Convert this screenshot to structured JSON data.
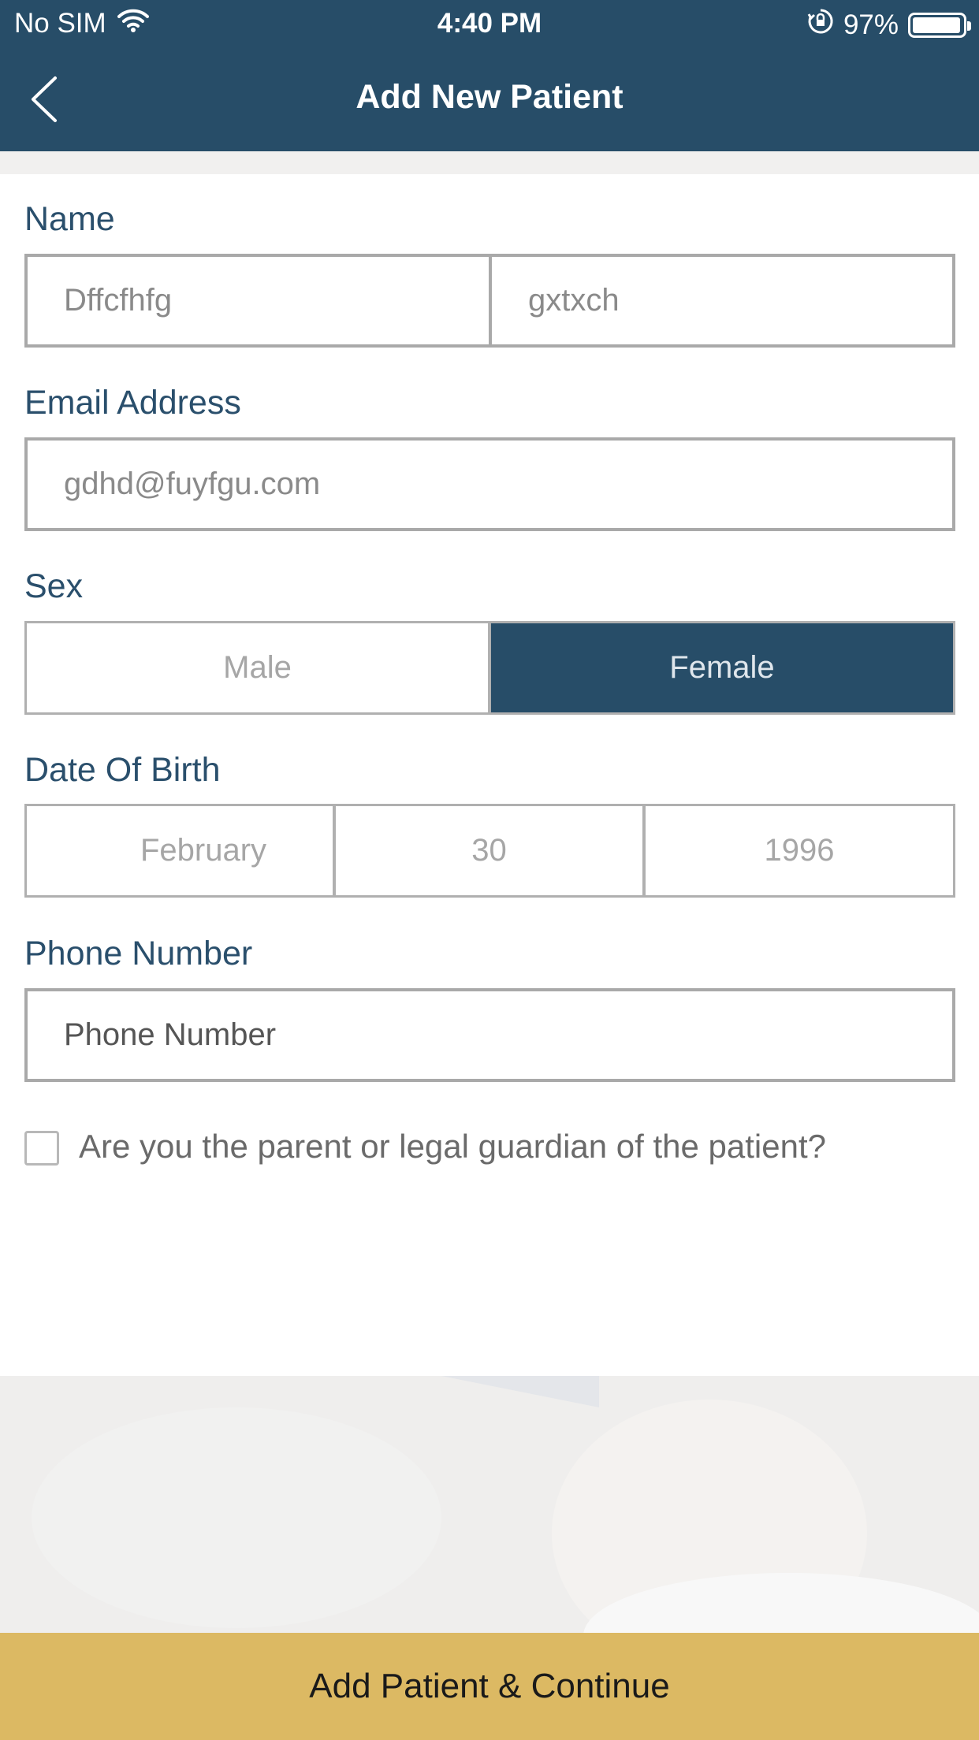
{
  "status_bar": {
    "carrier": "No SIM",
    "time": "4:40 PM",
    "battery_percent": "97%",
    "battery_level": 0.97
  },
  "nav": {
    "title": "Add New Patient"
  },
  "form": {
    "name_label": "Name",
    "first_name_value": "Dffcfhfg",
    "last_name_value": "gxtxch",
    "email_label": "Email Address",
    "email_value": "gdhd@fuyfgu.com",
    "sex_label": "Sex",
    "sex_options": [
      "Male",
      "Female"
    ],
    "sex_selected": "Female",
    "dob_label": "Date Of Birth",
    "dob_month": "February",
    "dob_day": "30",
    "dob_year": "1996",
    "phone_label": "Phone Number",
    "phone_placeholder": "Phone Number",
    "guardian_checkbox_label": "Are you the parent or legal guardian of the patient?",
    "guardian_checked": false
  },
  "actions": {
    "submit_label": "Add Patient & Continue"
  },
  "colors": {
    "header": "#274d68",
    "accent_button": "#dcb963",
    "label_text": "#2a4f6c"
  }
}
